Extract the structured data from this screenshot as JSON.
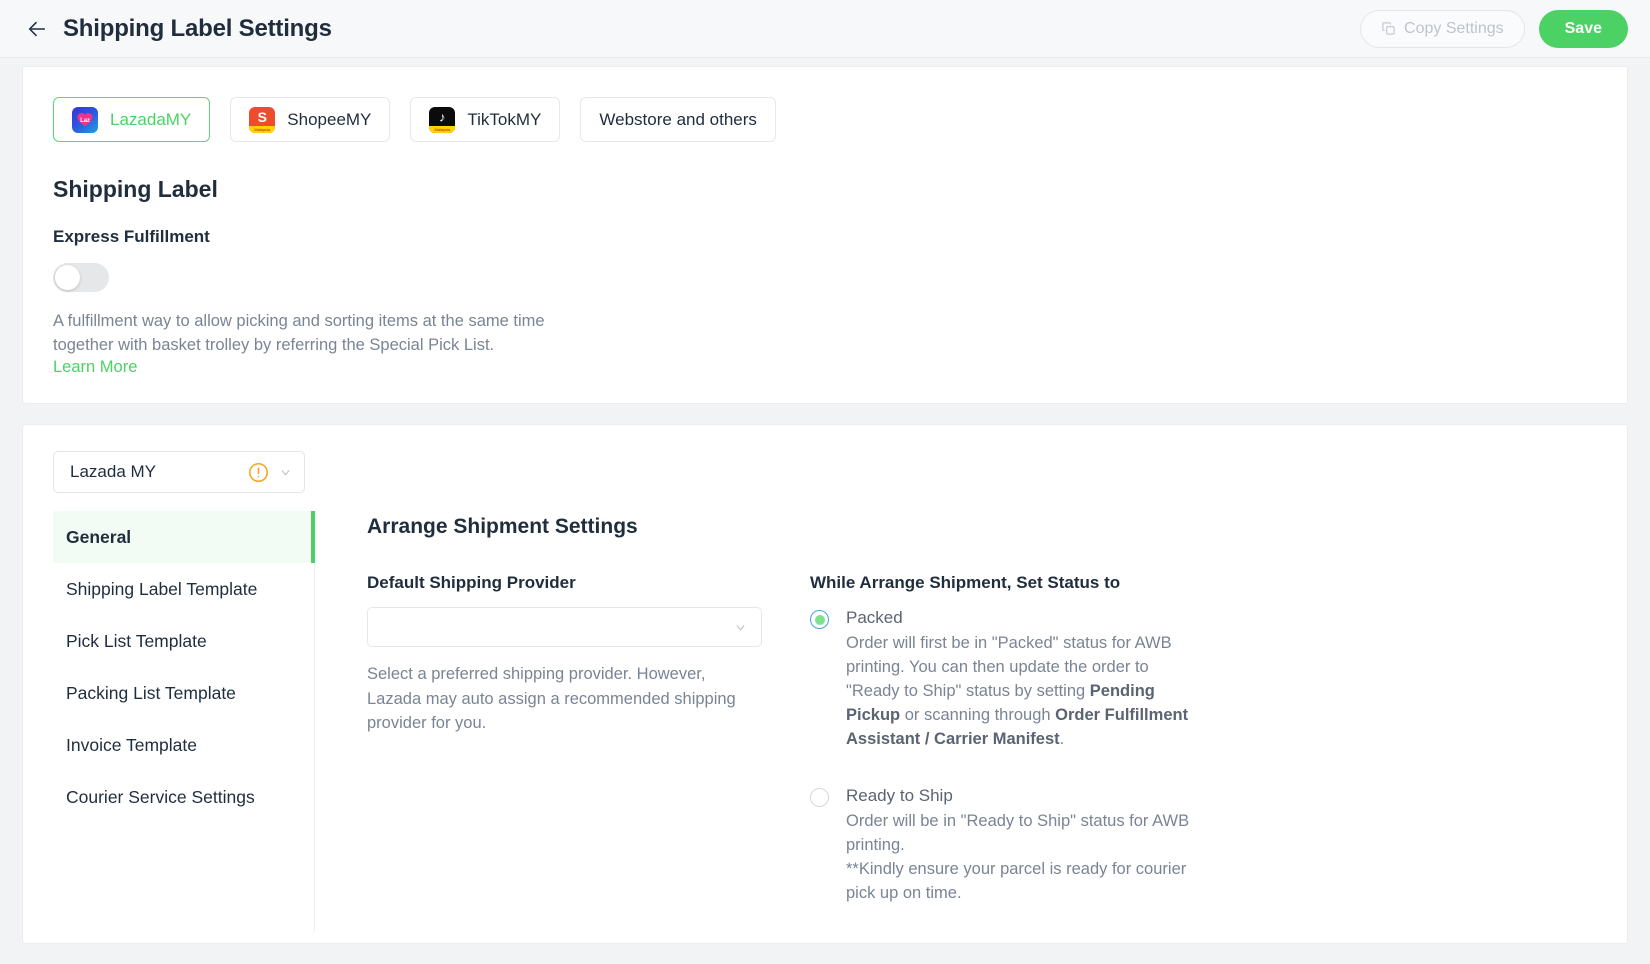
{
  "header": {
    "back_icon": "arrow-left-icon",
    "title": "Shipping Label Settings",
    "copy_settings_label": "Copy Settings",
    "copy_icon": "copy-icon",
    "save_label": "Save",
    "save_color": "#4cd264"
  },
  "marketplace_tabs": [
    {
      "label": "LazadaMY",
      "icon": "lazada-icon",
      "badge": "Malaysia",
      "active": true
    },
    {
      "label": "ShopeeMY",
      "icon": "shopee-icon",
      "badge": "Malaysia",
      "active": false
    },
    {
      "label": "TikTokMY",
      "icon": "tiktok-icon",
      "badge": "Malaysia",
      "active": false
    },
    {
      "label": "Webstore and others",
      "icon": "",
      "badge": "",
      "active": false
    }
  ],
  "shipping_label": {
    "section_title": "Shipping Label",
    "express_fulfillment_label": "Express Fulfillment",
    "express_fulfillment_enabled": false,
    "description": "A fulfillment way to allow picking and sorting items at the same time together with basket trolley by referring the Special Pick List.",
    "learn_more_label": "Learn More",
    "learn_more_color": "#4cd264"
  },
  "store_selector": {
    "value": "Lazada MY",
    "warning_icon": "warning-circle-icon",
    "warning_color": "#f5a623",
    "chevron_icon": "chevron-down-icon"
  },
  "side_nav": {
    "items": [
      {
        "label": "General",
        "active": true
      },
      {
        "label": "Shipping Label Template",
        "active": false
      },
      {
        "label": "Pick List Template",
        "active": false
      },
      {
        "label": "Packing List Template",
        "active": false
      },
      {
        "label": "Invoice Template",
        "active": false
      },
      {
        "label": "Courier Service Settings",
        "active": false
      }
    ],
    "active_indicator_color": "#4cd264"
  },
  "arrange_shipment": {
    "heading": "Arrange Shipment Settings",
    "provider": {
      "label": "Default Shipping Provider",
      "value": "",
      "placeholder": "",
      "chevron_icon": "chevron-down-icon",
      "help": "Select a preferred shipping provider. However, Lazada may auto assign a recommended shipping provider for you."
    },
    "status": {
      "label": "While Arrange Shipment, Set Status to",
      "options": [
        {
          "title": "Packed",
          "selected": true,
          "desc_parts": [
            {
              "text": "Order will first be in \"Packed\" status for AWB printing. You can then update the order to \"Ready to Ship\" status by setting ",
              "bold": false
            },
            {
              "text": "Pending Pickup",
              "bold": true
            },
            {
              "text": " or scanning through ",
              "bold": false
            },
            {
              "text": "Order Fulfillment Assistant / Carrier Manifest",
              "bold": true
            },
            {
              "text": ".",
              "bold": false
            }
          ]
        },
        {
          "title": "Ready to Ship",
          "selected": false,
          "desc_parts": [
            {
              "text": "Order will be in \"Ready to Ship\" status for AWB printing.\n**Kindly ensure your parcel is ready for courier pick up on time.",
              "bold": false
            }
          ]
        }
      ]
    }
  }
}
